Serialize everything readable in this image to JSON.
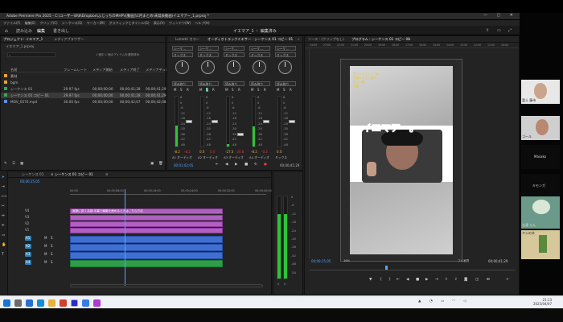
{
  "window": {
    "title": "Adobe Premiere Pro 2025 - C:\\ユーザー\\8\\8\\Dropbox\\ふじっちのMHP\\\\[動画]\\1月まとめ\\未発表動画\\イエマアー_1.prproj *",
    "controls": "— ▢ ✕"
  },
  "menubar": {
    "items": [
      "ファイル(F)",
      "編集(E)",
      "クリップ(C)",
      "シーケンス(S)",
      "マーカー(M)",
      "グラフィックとタイトル(G)",
      "表示(V)",
      "ウィンドウ(W)",
      "ヘルプ(H)"
    ]
  },
  "workspace": {
    "tabs": [
      "読み込み",
      "編集",
      "書き出し"
    ],
    "active_index": 1,
    "center_title": "イエマア_1 ・ 編集済み"
  },
  "project": {
    "tabs": [
      "プロジェクト: イエマア_1",
      "メディアブラウザー"
    ],
    "file": "イエマア_1.prproj",
    "selected_note": "1 個中 1 個のアイテムを選択済み",
    "columns": [
      "名前",
      "フレームレート",
      "メディア開始",
      "メディア終了",
      "メディアデュレーション"
    ],
    "rows": [
      {
        "name": "素材",
        "color": "#e6a33a",
        "rate": "",
        "start": "",
        "end": "",
        "dur": "",
        "selected": false
      },
      {
        "name": "bgm",
        "color": "#e6a33a",
        "rate": "",
        "start": "",
        "end": "",
        "dur": "",
        "selected": false
      },
      {
        "name": "シーケンス 01",
        "color": "#3aa55a",
        "rate": "29.97 fps",
        "start": "00;00;00;00",
        "end": "00;00;41;28",
        "dur": "00;00;41;29",
        "selected": false
      },
      {
        "name": "シーケンス 01 コピー 01",
        "color": "#3aa55a",
        "rate": "29.97 fps",
        "start": "00;00;00;00",
        "end": "00;00;41;28",
        "dur": "00;00;41;29",
        "selected": true
      },
      {
        "name": "MOV_0570.mp4",
        "color": "#5f8ae0",
        "rate": "30.00 fps",
        "start": "00;00;00;00",
        "end": "00;00;42;07",
        "dur": "00;00;42;08",
        "selected": false
      }
    ]
  },
  "mixer": {
    "tabs": [
      "Lumetri カラー",
      "オーディオトラックミキサー : シーケンス 01 コピー 01",
      "»"
    ],
    "dropdowns": [
      "シーケ...",
      "シーケ...",
      "シーケ...",
      "シーケ...",
      "シーケ..."
    ],
    "dropdowns2": [
      "ミックス",
      "ミックス",
      "ミックス",
      "ミックス",
      "ミックス"
    ],
    "modes": [
      "読み取り",
      "読み取り",
      "読み取り",
      "読み取り",
      "読み取り"
    ],
    "channels": [
      "A1  オーディオ",
      "A2  オーディオ",
      "A3  オーディオ",
      "A4  オーディオ",
      "ミックス"
    ],
    "levels": [
      "-8.2",
      "0.0",
      "-27.0",
      "-8.2",
      "0.0"
    ],
    "peaks": [
      "-8.2",
      "0.0",
      "-26.8",
      "-0.2",
      ""
    ],
    "level_fraction": [
      0.42,
      0.0,
      0.05,
      0.4,
      0.0
    ],
    "scale": [
      "6",
      "0",
      "-6",
      "-12",
      "-18",
      "-24",
      "-30",
      "-36",
      "-42",
      "-48"
    ],
    "timecode_left": "00;01;02;05",
    "timecode_right": "00;00;41;29"
  },
  "program": {
    "tabs": [
      "ソース : (クリップなし)",
      "プログラム : シーケンス 01 コピー 01",
      "≡"
    ],
    "caption": "イエマアー。",
    "overlay_lines": [
      "タイトルゴシック体",
      "字幕テキスト表示",
      "ガイド線",
      "字幕"
    ],
    "timecode_left": "00;00;15;05",
    "zoom": "16%",
    "fit": "フル画質",
    "timecode_right": "00;00;41;29",
    "ruler": [
      "24:00",
      "23:00",
      "22:00",
      "21:00",
      "20:00",
      "19:00",
      "18:00",
      "17:00",
      "16:00",
      "15:00",
      "14:00",
      "13:00",
      "12:00",
      "11:00",
      "10:00"
    ]
  },
  "timeline": {
    "tabs": [
      "シーケンス 01",
      "× シーケンス 01 コピー 01",
      "≡"
    ],
    "timecode": "00;00;15;05",
    "ruler": [
      "00;00",
      "00;00;08;00",
      "00;00;16;00",
      "00;00;24;00",
      "00;00;32;00",
      "00;00;40;00"
    ],
    "video_tracks": [
      "V4",
      "V3",
      "V2",
      "V1"
    ],
    "audio_tracks": [
      "A1",
      "A2",
      "A3",
      "A4"
    ],
    "clip_text": "実際に見て共感!字幕で編集を進めるときはこちら方法"
  },
  "audio_meter": {
    "scale": [
      "0",
      "-6",
      "-12",
      "-18",
      "-24",
      "-30",
      "-36",
      "-42",
      "-48",
      "-54"
    ],
    "labels": [
      "S",
      "S"
    ],
    "level_fraction": [
      0.78,
      0.78
    ]
  },
  "taskbar": {
    "time": "21:13",
    "date": "2025/04/07"
  },
  "zoom": {
    "participants": [
      "富士 藤市",
      "ゴール",
      "Masako",
      "キモンガ",
      "吉澤 らん",
      "ヤシの木"
    ]
  }
}
